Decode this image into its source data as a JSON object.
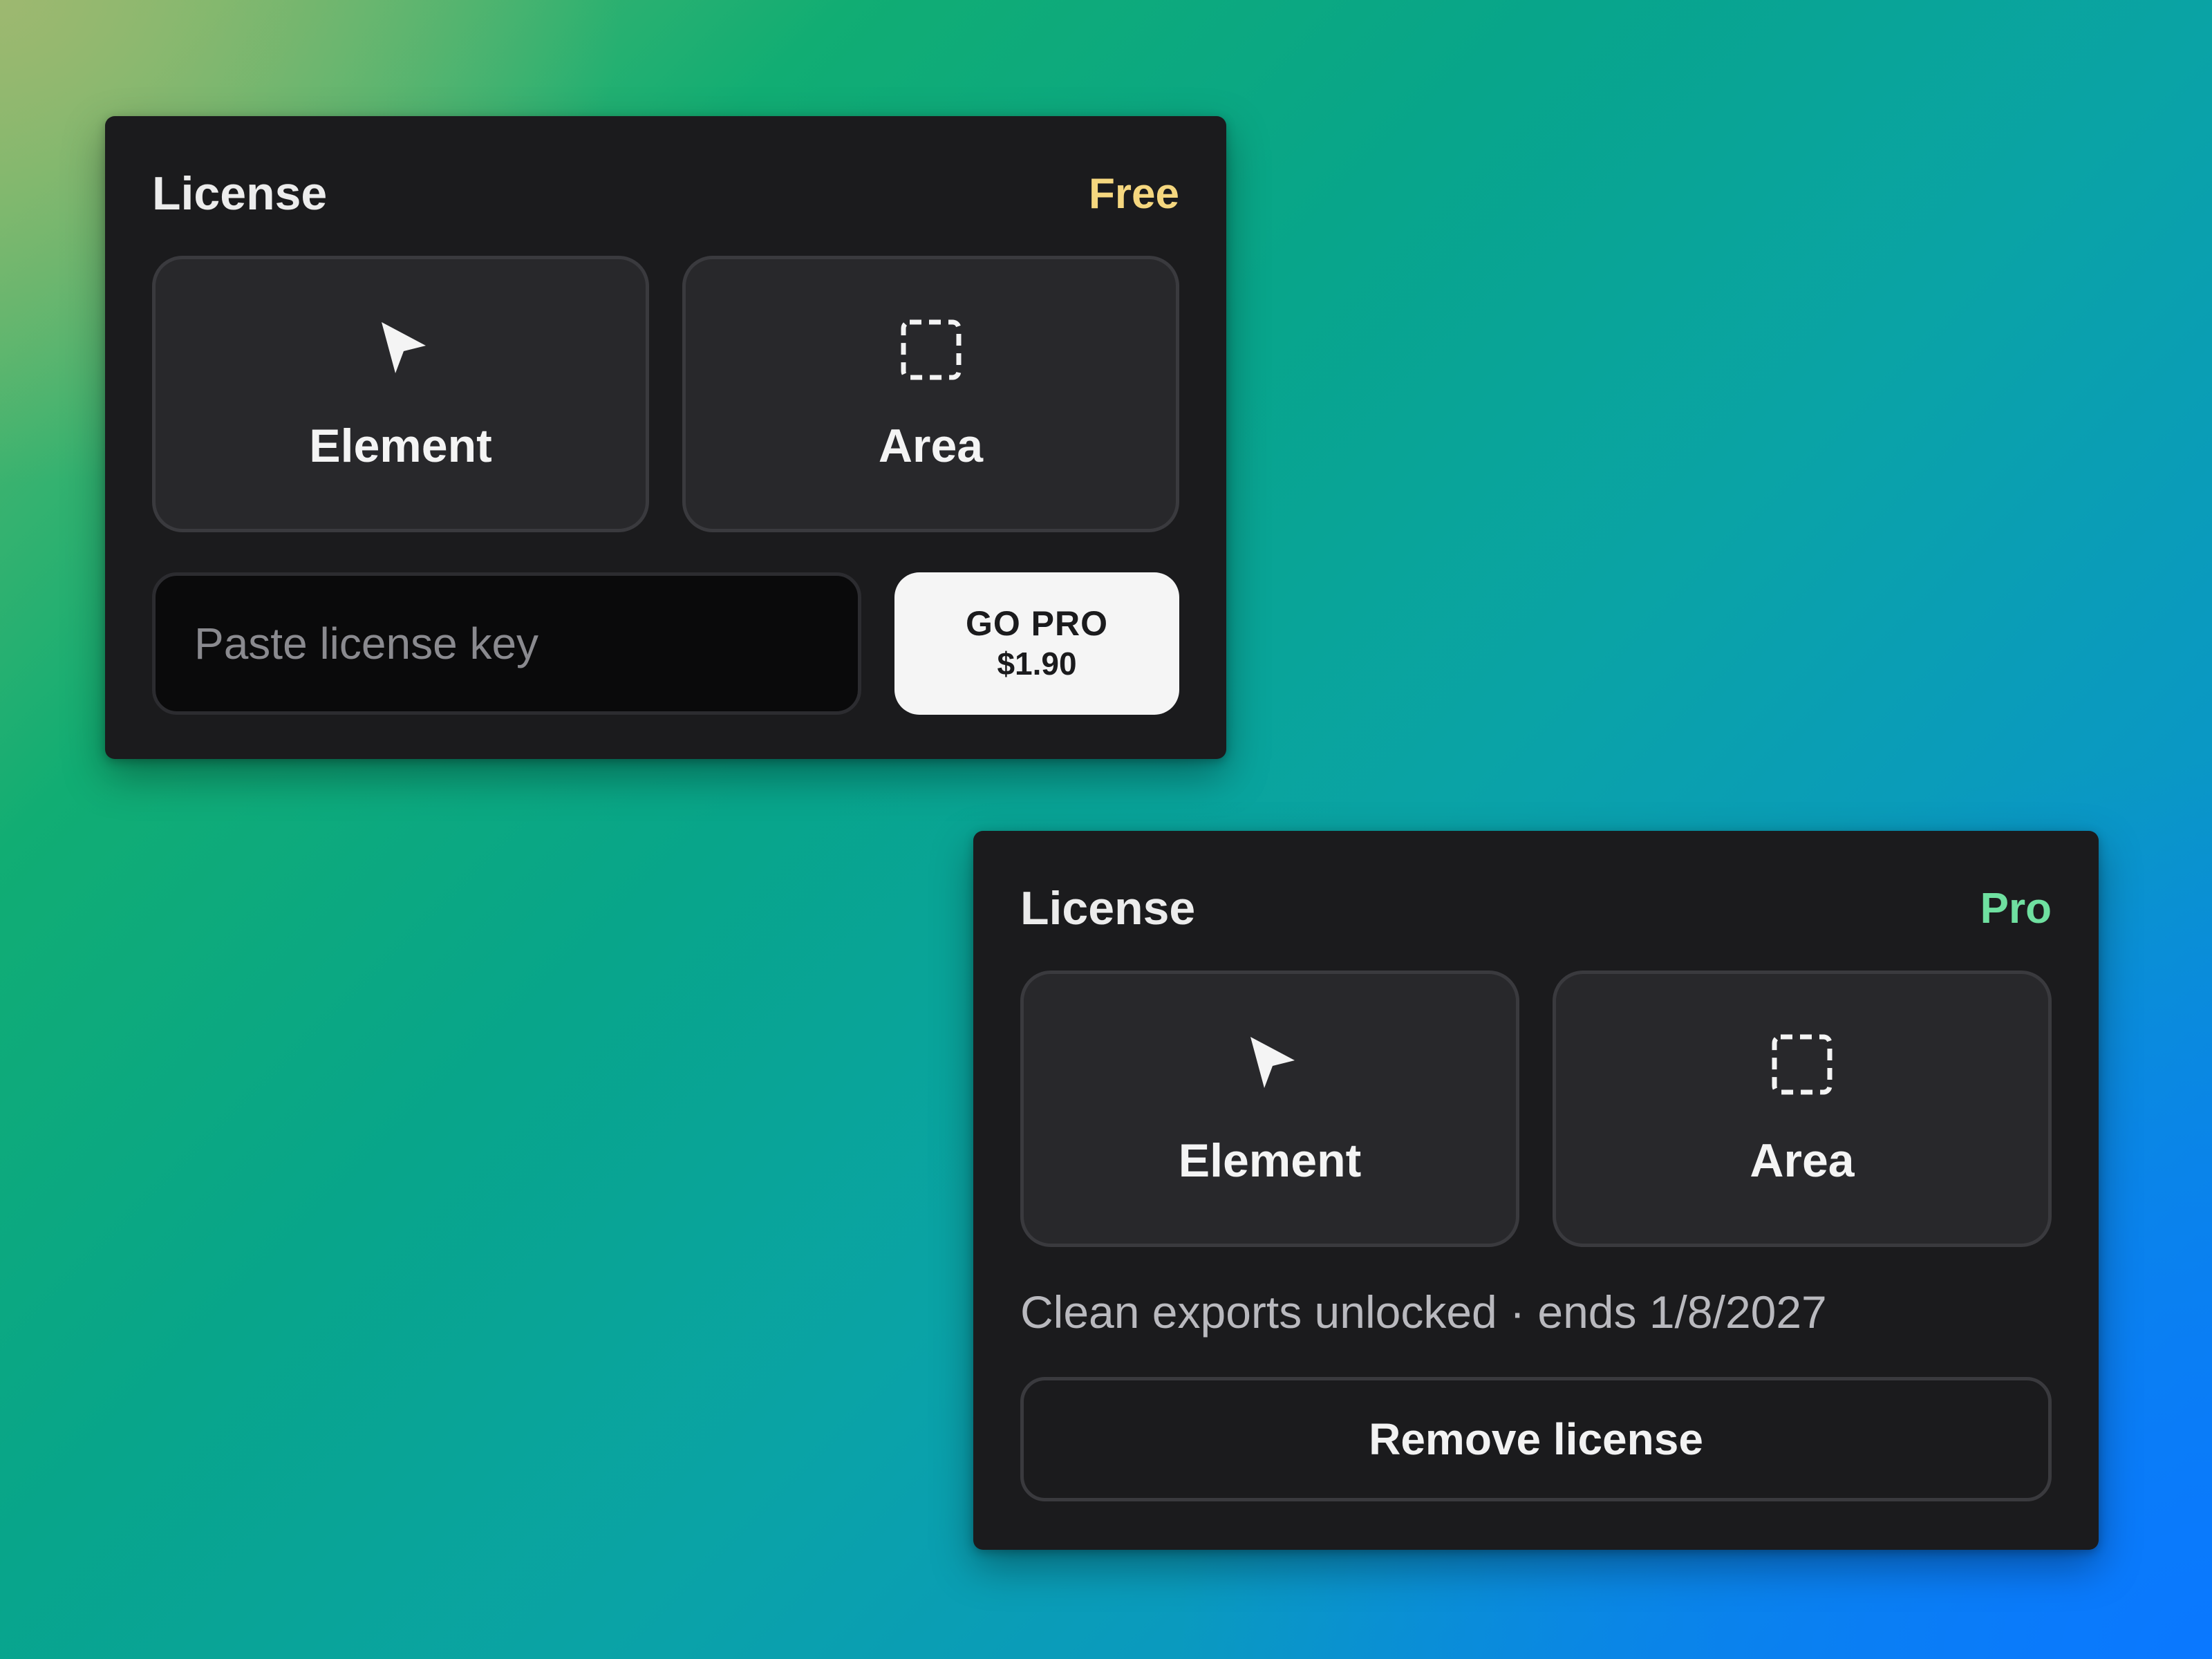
{
  "colors": {
    "free_badge": "#f5d77f",
    "pro_badge": "#6fe0a0",
    "panel_bg": "#1b1b1d"
  },
  "panels": [
    {
      "title": "License",
      "plan": "Free",
      "modes": [
        {
          "label": "Element",
          "icon": "cursor-arrow-icon"
        },
        {
          "label": "Area",
          "icon": "dashed-selection-icon"
        }
      ],
      "license_input": {
        "value": "",
        "placeholder": "Paste license key"
      },
      "go_pro": {
        "label": "GO PRO",
        "price": "$1.90"
      }
    },
    {
      "title": "License",
      "plan": "Pro",
      "modes": [
        {
          "label": "Element",
          "icon": "cursor-arrow-icon"
        },
        {
          "label": "Area",
          "icon": "dashed-selection-icon"
        }
      ],
      "status": "Clean exports unlocked · ends 1/8/2027",
      "remove_label": "Remove license"
    }
  ]
}
